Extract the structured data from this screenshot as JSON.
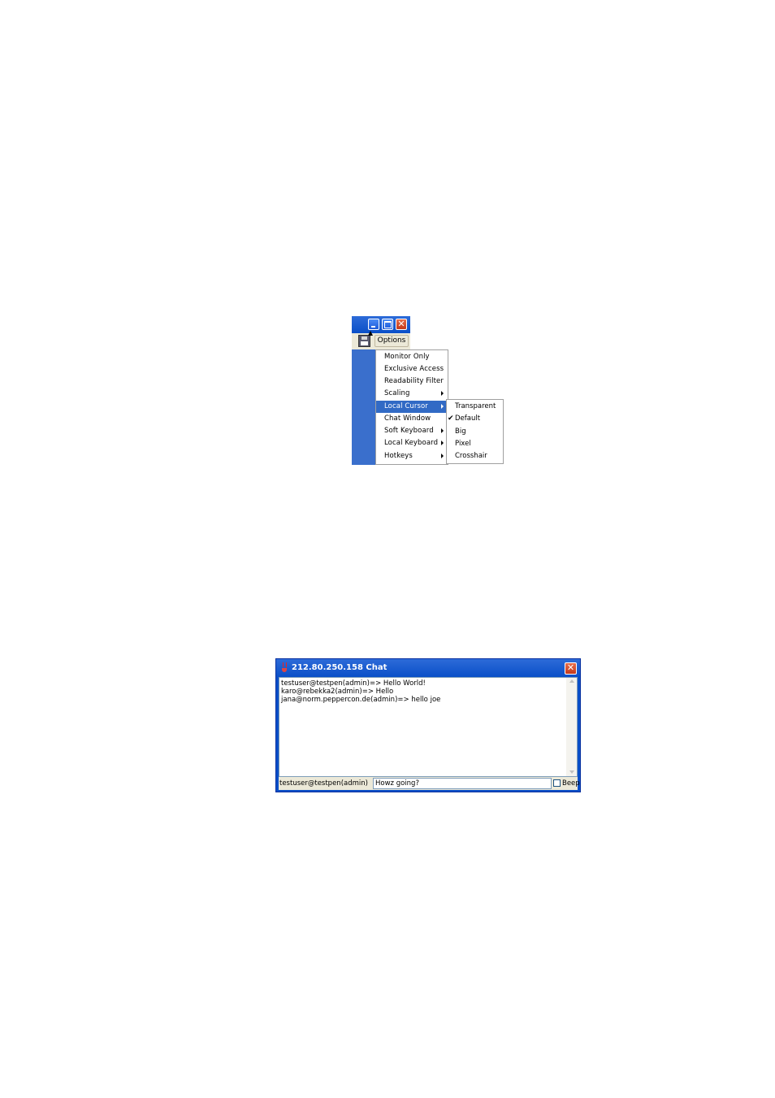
{
  "options_menu": {
    "toolbar": {
      "options_label": "Options"
    },
    "items": [
      {
        "label": "Monitor Only",
        "submenu": false
      },
      {
        "label": "Exclusive Access",
        "submenu": false
      },
      {
        "label": "Readability Filter",
        "submenu": false
      },
      {
        "label": "Scaling",
        "submenu": true
      },
      {
        "label": "Local Cursor",
        "submenu": true,
        "selected": true
      },
      {
        "label": "Chat Window",
        "submenu": false
      },
      {
        "label": "Soft Keyboard",
        "submenu": true
      },
      {
        "label": "Local Keyboard",
        "submenu": true
      },
      {
        "label": "Hotkeys",
        "submenu": true
      }
    ],
    "cursor_submenu": [
      {
        "label": "Transparent",
        "checked": false
      },
      {
        "label": "Default",
        "checked": true
      },
      {
        "label": "Big",
        "checked": false
      },
      {
        "label": "Pixel",
        "checked": false
      },
      {
        "label": "Crosshair",
        "checked": false
      }
    ],
    "check_glyph": "✔"
  },
  "chat": {
    "title": "212.80.250.158 Chat",
    "close_glyph": "✕",
    "messages": [
      "testuser@testpen(admin)=> Hello World!",
      "karo@rebekka2(admin)=> Hello",
      "jana@norm.peppercon.de(admin)=> hello joe"
    ],
    "user_label": "testuser@testpen(admin)",
    "input_value": "Howz going?",
    "beep_label": "Beep",
    "beep_checked": false
  },
  "colors": {
    "xp_title_blue": "#0a4fc8",
    "menu_highlight": "#316ac5",
    "xp_face": "#ece9d8",
    "close_red": "#c3391b"
  }
}
